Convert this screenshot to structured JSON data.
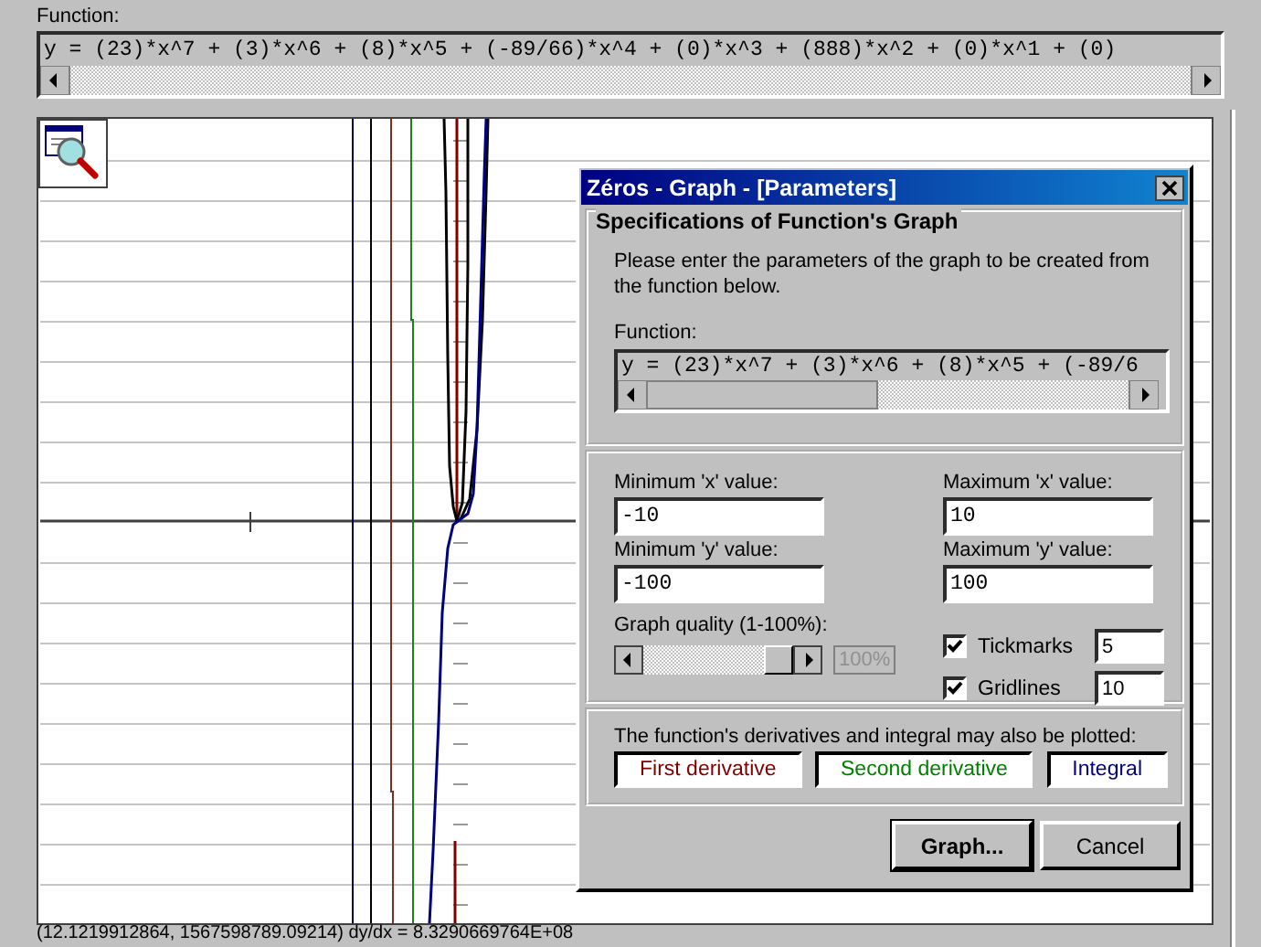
{
  "main": {
    "function_label": "Function:",
    "function_value": "y = (23)*x^7 + (3)*x^6 + (8)*x^5 + (-89/66)*x^4 + (0)*x^3 + (888)*x^2 + (0)*x^1 + (0)",
    "status": "(12.1219912864, 1567598789.09214) dy/dx = 8.3290669764E+08"
  },
  "dialog": {
    "title": "Zéros - Graph - [Parameters]",
    "specs": {
      "heading": "Specifications of Function's Graph",
      "description": "Please enter the parameters of the graph to be created from the function below.",
      "function_label": "Function:",
      "function_value": "y = (23)*x^7 + (3)*x^6 + (8)*x^5 + (-89/6"
    },
    "ranges": [
      {
        "label": "Minimum 'x' value:",
        "value": "-10"
      },
      {
        "label": "Maximum 'x' value:",
        "value": "10"
      },
      {
        "label": "Minimum 'y' value:",
        "value": "-100"
      },
      {
        "label": "Maximum 'y' value:",
        "value": "100"
      }
    ],
    "quality": {
      "label": "Graph quality (1-100%):",
      "level": 1,
      "reading": "100%"
    },
    "options": [
      {
        "label": "Tickmarks",
        "checked": true,
        "value": "5"
      },
      {
        "label": "Gridlines",
        "checked": true,
        "value": "10"
      }
    ],
    "plots": {
      "caption": "The function's derivatives and integral may also be plotted:",
      "buttons": [
        {
          "label": "First derivative",
          "color": "#800000"
        },
        {
          "label": "Second derivative",
          "color": "#008000"
        },
        {
          "label": "Integral",
          "color": "#000080"
        }
      ]
    },
    "buttons": [
      {
        "label": "Graph...",
        "default": true
      },
      {
        "label": "Cancel",
        "default": false
      }
    ]
  }
}
